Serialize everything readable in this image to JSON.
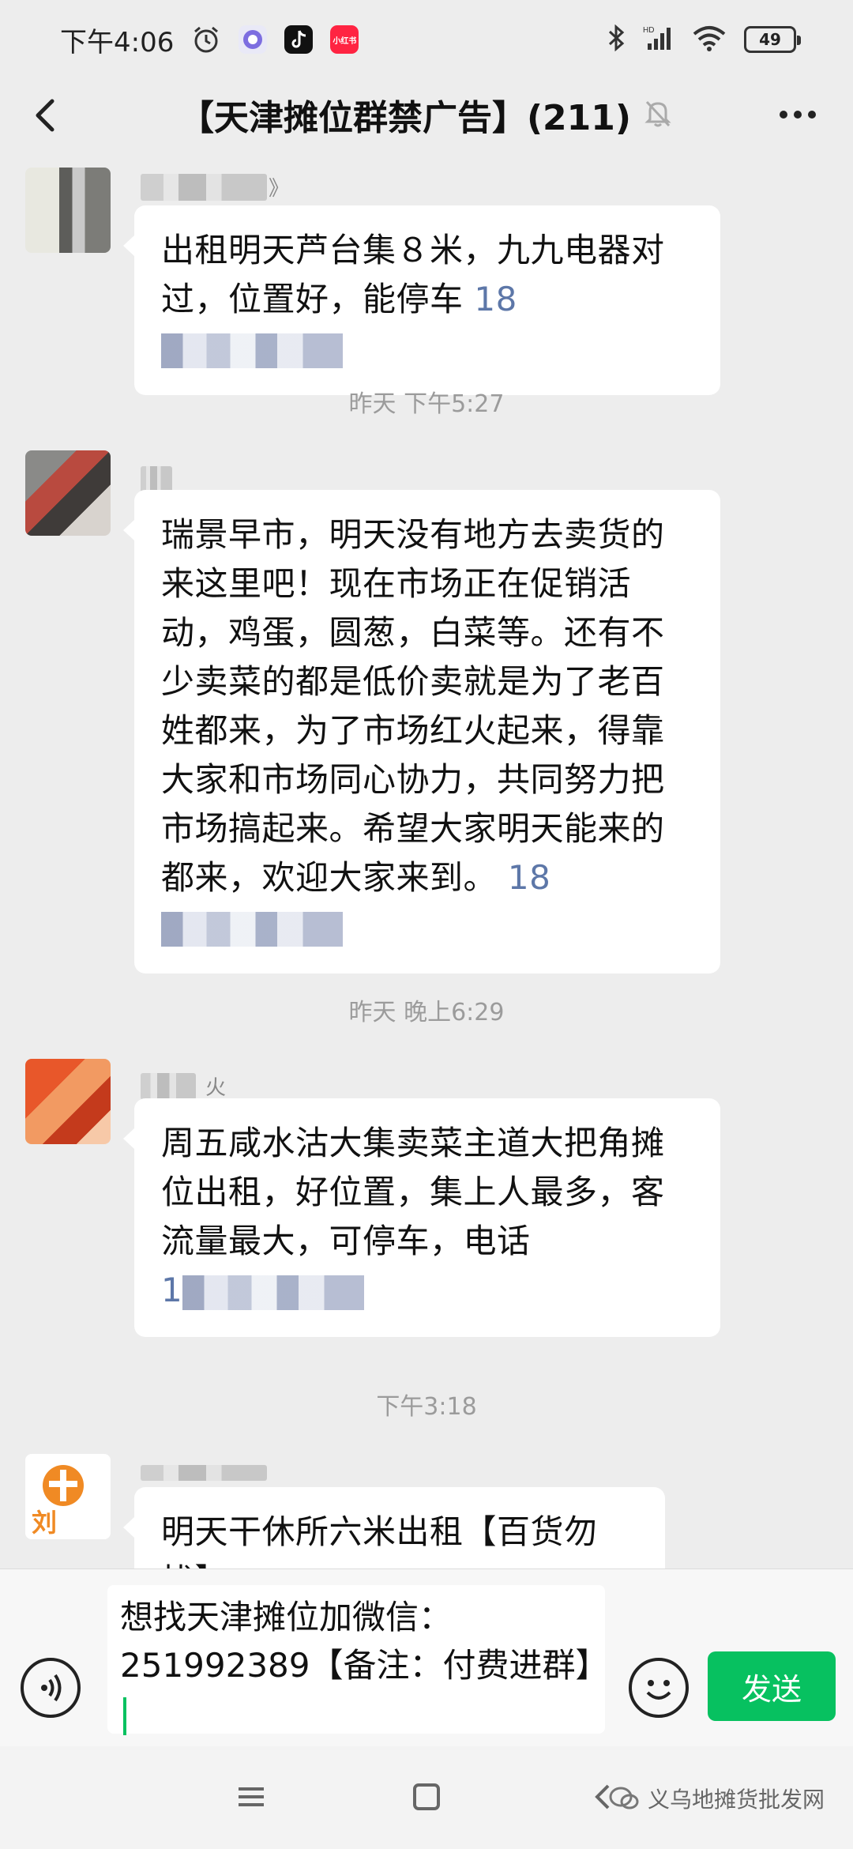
{
  "status_bar": {
    "time": "下午4:06",
    "app_badge_label": "小红书",
    "battery": "49"
  },
  "header": {
    "title": "【天津摊位群禁广告】(211)"
  },
  "messages": [
    {
      "text": "出租明天芦台集８米，九九电器对过，位置好，能停车",
      "phone_prefix": "18",
      "sender_partial": "》"
    },
    {
      "text": "瑞景早市，明天没有地方去卖货的来这里吧！现在市场正在促销活动，鸡蛋，圆葱，白菜等。还有不少卖菜的都是低价卖就是为了老百姓都来，为了市场红火起来，得靠大家和市场同心协力，共同努力把市场搞起来。希望大家明天能来的都来，欢迎大家来到。",
      "phone_prefix": "18"
    },
    {
      "text": "周五咸水沽大集卖菜主道大把角摊位出租，好位置，集上人最多，客流量最大，可停车，电话",
      "phone_prefix": "1",
      "sender_partial": "火"
    },
    {
      "text": "明天干休所六米出租【百货勿扰】",
      "avatar_label": "刘"
    }
  ],
  "timestamps": [
    "昨天 下午5:27",
    "昨天 晚上6:29",
    "下午3:18"
  ],
  "input": {
    "value": "想找天津摊位加微信：251992389【备注：付费进群】"
  },
  "send_label": "发送",
  "watermark": "义乌地摊货批发网",
  "colors": {
    "accent_green": "#07c160",
    "phone_blue": "#5d77a8",
    "background": "#ededed"
  }
}
